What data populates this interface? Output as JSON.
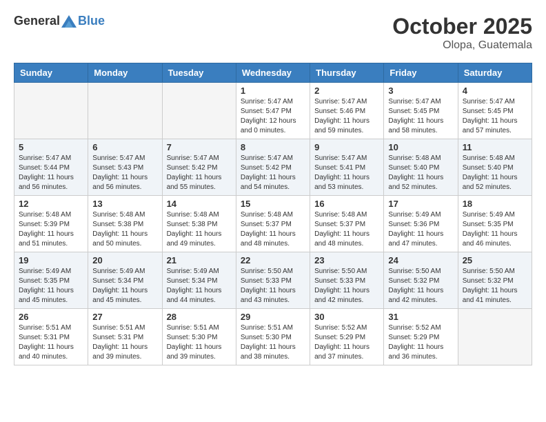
{
  "header": {
    "logo_line1": "General",
    "logo_line2": "Blue",
    "month": "October 2025",
    "location": "Olopa, Guatemala"
  },
  "weekdays": [
    "Sunday",
    "Monday",
    "Tuesday",
    "Wednesday",
    "Thursday",
    "Friday",
    "Saturday"
  ],
  "weeks": [
    {
      "shaded": false,
      "days": [
        {
          "num": "",
          "empty": true
        },
        {
          "num": "",
          "empty": true
        },
        {
          "num": "",
          "empty": true
        },
        {
          "num": "1",
          "sunrise": "5:47 AM",
          "sunset": "5:47 PM",
          "daylight": "12 hours and 0 minutes."
        },
        {
          "num": "2",
          "sunrise": "5:47 AM",
          "sunset": "5:46 PM",
          "daylight": "11 hours and 59 minutes."
        },
        {
          "num": "3",
          "sunrise": "5:47 AM",
          "sunset": "5:45 PM",
          "daylight": "11 hours and 58 minutes."
        },
        {
          "num": "4",
          "sunrise": "5:47 AM",
          "sunset": "5:45 PM",
          "daylight": "11 hours and 57 minutes."
        }
      ]
    },
    {
      "shaded": true,
      "days": [
        {
          "num": "5",
          "sunrise": "5:47 AM",
          "sunset": "5:44 PM",
          "daylight": "11 hours and 56 minutes."
        },
        {
          "num": "6",
          "sunrise": "5:47 AM",
          "sunset": "5:43 PM",
          "daylight": "11 hours and 56 minutes."
        },
        {
          "num": "7",
          "sunrise": "5:47 AM",
          "sunset": "5:42 PM",
          "daylight": "11 hours and 55 minutes."
        },
        {
          "num": "8",
          "sunrise": "5:47 AM",
          "sunset": "5:42 PM",
          "daylight": "11 hours and 54 minutes."
        },
        {
          "num": "9",
          "sunrise": "5:47 AM",
          "sunset": "5:41 PM",
          "daylight": "11 hours and 53 minutes."
        },
        {
          "num": "10",
          "sunrise": "5:48 AM",
          "sunset": "5:40 PM",
          "daylight": "11 hours and 52 minutes."
        },
        {
          "num": "11",
          "sunrise": "5:48 AM",
          "sunset": "5:40 PM",
          "daylight": "11 hours and 52 minutes."
        }
      ]
    },
    {
      "shaded": false,
      "days": [
        {
          "num": "12",
          "sunrise": "5:48 AM",
          "sunset": "5:39 PM",
          "daylight": "11 hours and 51 minutes."
        },
        {
          "num": "13",
          "sunrise": "5:48 AM",
          "sunset": "5:38 PM",
          "daylight": "11 hours and 50 minutes."
        },
        {
          "num": "14",
          "sunrise": "5:48 AM",
          "sunset": "5:38 PM",
          "daylight": "11 hours and 49 minutes."
        },
        {
          "num": "15",
          "sunrise": "5:48 AM",
          "sunset": "5:37 PM",
          "daylight": "11 hours and 48 minutes."
        },
        {
          "num": "16",
          "sunrise": "5:48 AM",
          "sunset": "5:37 PM",
          "daylight": "11 hours and 48 minutes."
        },
        {
          "num": "17",
          "sunrise": "5:49 AM",
          "sunset": "5:36 PM",
          "daylight": "11 hours and 47 minutes."
        },
        {
          "num": "18",
          "sunrise": "5:49 AM",
          "sunset": "5:35 PM",
          "daylight": "11 hours and 46 minutes."
        }
      ]
    },
    {
      "shaded": true,
      "days": [
        {
          "num": "19",
          "sunrise": "5:49 AM",
          "sunset": "5:35 PM",
          "daylight": "11 hours and 45 minutes."
        },
        {
          "num": "20",
          "sunrise": "5:49 AM",
          "sunset": "5:34 PM",
          "daylight": "11 hours and 45 minutes."
        },
        {
          "num": "21",
          "sunrise": "5:49 AM",
          "sunset": "5:34 PM",
          "daylight": "11 hours and 44 minutes."
        },
        {
          "num": "22",
          "sunrise": "5:50 AM",
          "sunset": "5:33 PM",
          "daylight": "11 hours and 43 minutes."
        },
        {
          "num": "23",
          "sunrise": "5:50 AM",
          "sunset": "5:33 PM",
          "daylight": "11 hours and 42 minutes."
        },
        {
          "num": "24",
          "sunrise": "5:50 AM",
          "sunset": "5:32 PM",
          "daylight": "11 hours and 42 minutes."
        },
        {
          "num": "25",
          "sunrise": "5:50 AM",
          "sunset": "5:32 PM",
          "daylight": "11 hours and 41 minutes."
        }
      ]
    },
    {
      "shaded": false,
      "days": [
        {
          "num": "26",
          "sunrise": "5:51 AM",
          "sunset": "5:31 PM",
          "daylight": "11 hours and 40 minutes."
        },
        {
          "num": "27",
          "sunrise": "5:51 AM",
          "sunset": "5:31 PM",
          "daylight": "11 hours and 39 minutes."
        },
        {
          "num": "28",
          "sunrise": "5:51 AM",
          "sunset": "5:30 PM",
          "daylight": "11 hours and 39 minutes."
        },
        {
          "num": "29",
          "sunrise": "5:51 AM",
          "sunset": "5:30 PM",
          "daylight": "11 hours and 38 minutes."
        },
        {
          "num": "30",
          "sunrise": "5:52 AM",
          "sunset": "5:29 PM",
          "daylight": "11 hours and 37 minutes."
        },
        {
          "num": "31",
          "sunrise": "5:52 AM",
          "sunset": "5:29 PM",
          "daylight": "11 hours and 36 minutes."
        },
        {
          "num": "",
          "empty": true
        }
      ]
    }
  ],
  "labels": {
    "sunrise_prefix": "Sunrise: ",
    "sunset_prefix": "Sunset: ",
    "daylight_prefix": "Daylight: "
  }
}
